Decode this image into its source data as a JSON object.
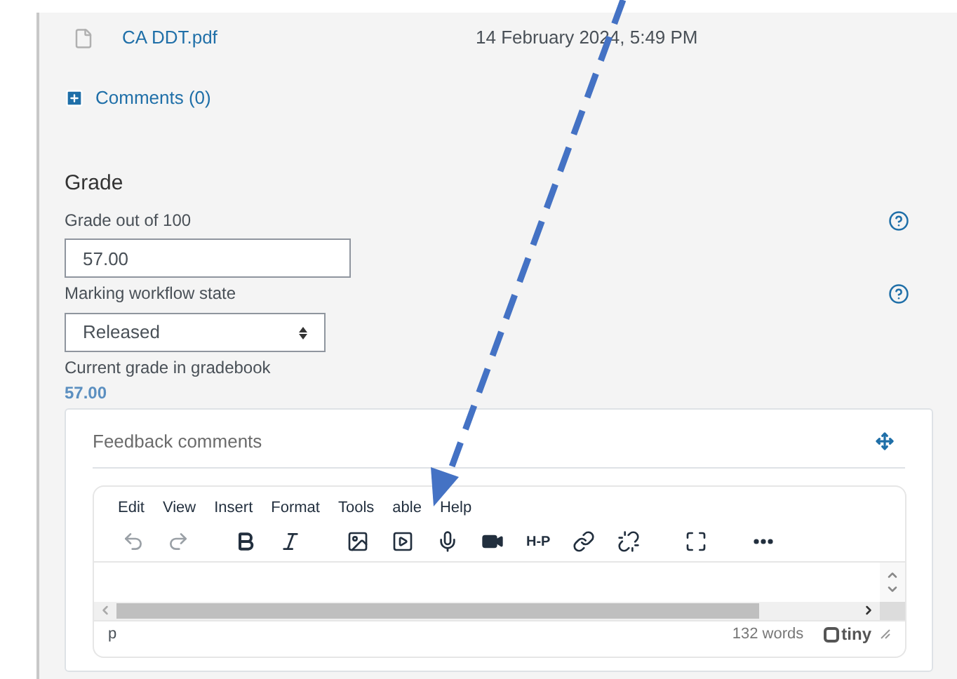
{
  "file": {
    "name": "CA DDT.pdf",
    "date": "14 February 2024, 5:49 PM"
  },
  "comments": {
    "label": "Comments (0)"
  },
  "grade": {
    "heading": "Grade",
    "grade_label": "Grade out of 100",
    "grade_value": "57.00",
    "workflow_label": "Marking workflow state",
    "workflow_value": "Released",
    "current_label": "Current grade in gradebook",
    "current_value": "57.00"
  },
  "feedback": {
    "title": "Feedback comments",
    "menu": [
      "Edit",
      "View",
      "Insert",
      "Format",
      "Tools",
      "able",
      "Help"
    ],
    "toolbar": [
      {
        "kind": "undo",
        "disabled": true
      },
      {
        "kind": "redo",
        "disabled": true
      },
      {
        "kind": "bold",
        "disabled": false
      },
      {
        "kind": "italic",
        "disabled": false
      },
      {
        "kind": "image",
        "disabled": false
      },
      {
        "kind": "media",
        "disabled": false
      },
      {
        "kind": "mic",
        "disabled": false
      },
      {
        "kind": "video",
        "disabled": false
      },
      {
        "kind": "h5p",
        "label": "H-P",
        "disabled": false
      },
      {
        "kind": "link",
        "disabled": false
      },
      {
        "kind": "unlink",
        "disabled": false
      },
      {
        "kind": "fullscreen",
        "disabled": false
      },
      {
        "kind": "more",
        "disabled": false
      }
    ],
    "path": "p",
    "word_count": "132 words",
    "brand": "tiny"
  }
}
